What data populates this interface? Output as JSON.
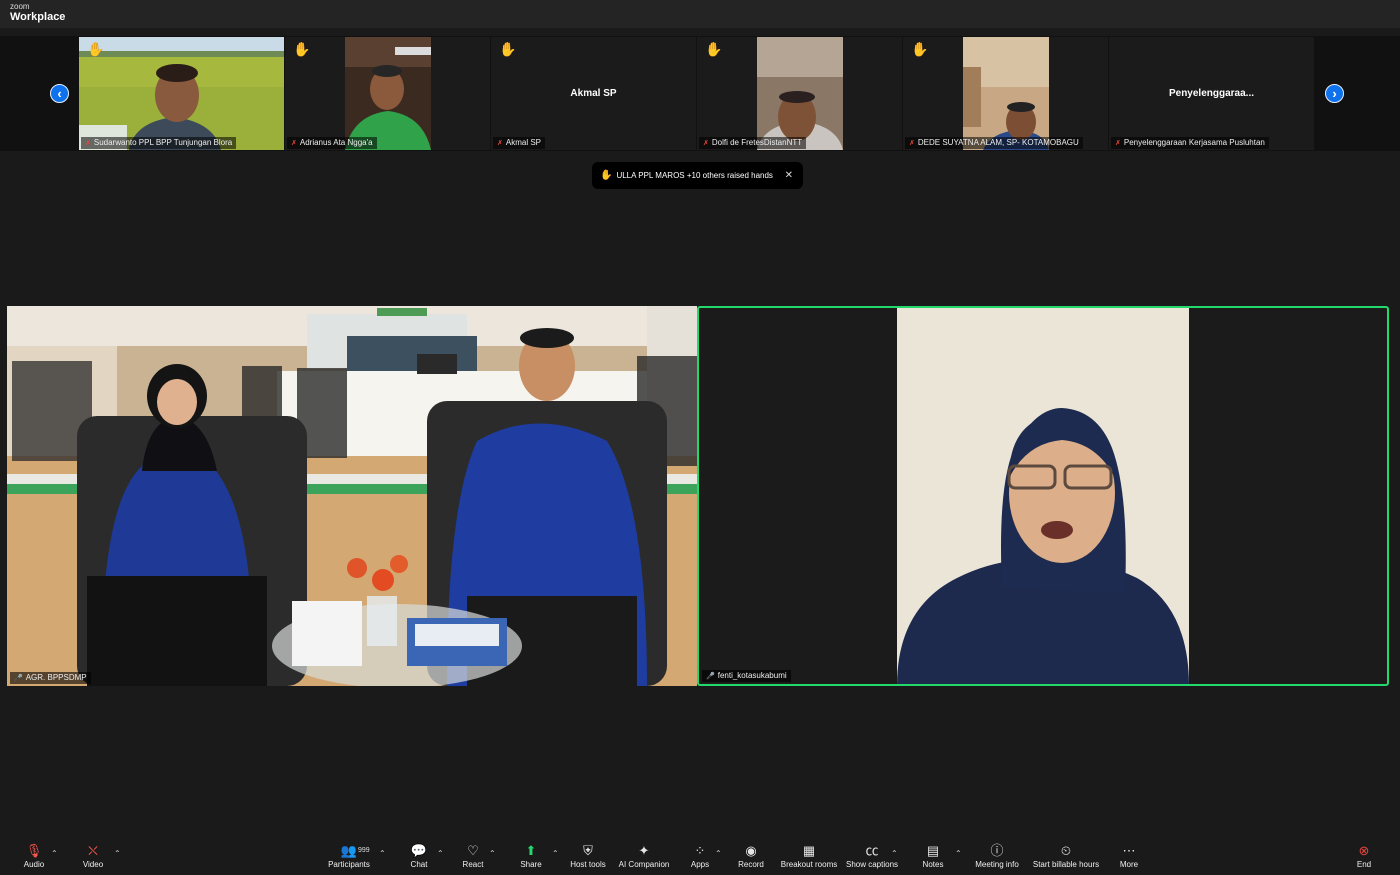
{
  "app": {
    "brand_line1": "zoom",
    "brand_line2": "Workplace"
  },
  "gallery": {
    "tiles": [
      {
        "name": "Sudarwanto PPL BPP Tunjungan Blora",
        "hand_raised": true,
        "muted": true,
        "video": true
      },
      {
        "name": "Adrianus Ata Ngga'a",
        "hand_raised": true,
        "muted": true,
        "video": true
      },
      {
        "name": "Akmal SP",
        "display_name": "Akmal SP",
        "hand_raised": true,
        "muted": true,
        "video": false
      },
      {
        "name": "Dolfi de FretesDistanNTT",
        "hand_raised": true,
        "muted": true,
        "video": true
      },
      {
        "name": "DEDE SUYATNA ALAM, SP- KOTAMOBAGU",
        "hand_raised": true,
        "muted": true,
        "video": true
      },
      {
        "name": "Penyelenggaraan Kerjasama Pusluhtan",
        "display_name": "Penyelenggaraa...",
        "hand_raised": false,
        "muted": true,
        "video": false
      }
    ],
    "prev_icon": "chevron-left-icon",
    "next_icon": "chevron-right-icon"
  },
  "raised_hands": {
    "text": "ULLA PPL MAROS +10 others raised hands",
    "icon": "raised-hand-icon"
  },
  "main": {
    "left": {
      "name": "AGR. BPPSDMP"
    },
    "right": {
      "name": "fenti_kotasukabumi",
      "active_speaker": true
    }
  },
  "toolbar": {
    "audio": "Audio",
    "video": "Video",
    "participants": "Participants",
    "participants_count": "999",
    "chat": "Chat",
    "react": "React",
    "share": "Share",
    "host_tools": "Host tools",
    "ai_companion": "AI Companion",
    "apps": "Apps",
    "record": "Record",
    "breakout_rooms": "Breakout rooms",
    "show_captions": "Show captions",
    "notes": "Notes",
    "meeting_info": "Meeting info",
    "start_billable_hours": "Start billable hours",
    "more": "More",
    "end": "End"
  },
  "colors": {
    "accent": "#0e72ed",
    "active_speaker": "#23d96b",
    "end": "#e5473d",
    "raised_hand": "#f6b928",
    "share": "#23d96b"
  }
}
